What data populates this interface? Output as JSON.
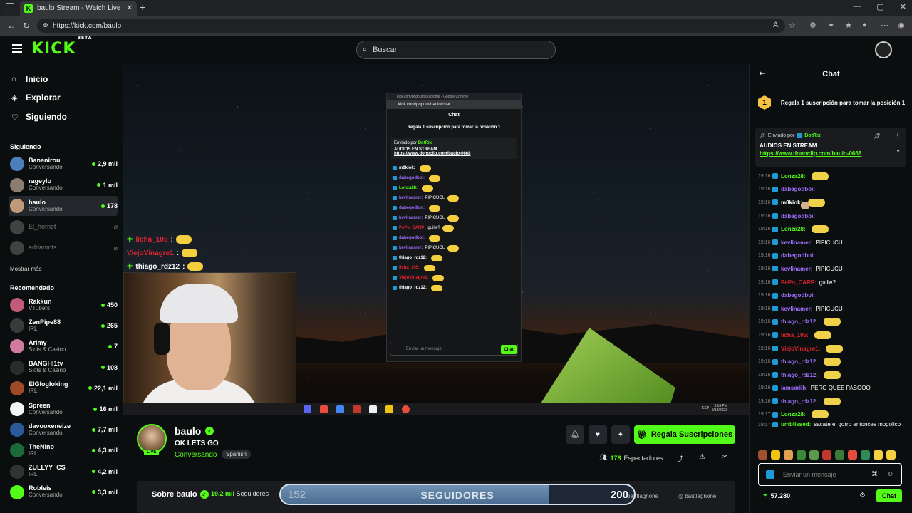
{
  "browser": {
    "tab_title": "baulo Stream - Watch Live o",
    "url": "https://kick.com/baulo",
    "new_tab": "+",
    "window_controls": [
      "—",
      "▢",
      "✕"
    ]
  },
  "header": {
    "logo": "KICK",
    "logo_tag": "BETA",
    "search_placeholder": "Buscar"
  },
  "sidebar": {
    "nav": [
      {
        "label": "Inicio",
        "icon": "home-icon"
      },
      {
        "label": "Explorar",
        "icon": "compass-icon"
      },
      {
        "label": "Siguiendo",
        "icon": "heart-icon"
      }
    ],
    "following_title": "Siguiendo",
    "following": [
      {
        "name": "Bananirou",
        "category": "Conversando",
        "viewers": "2,9 mil",
        "color": "#4c7fb8"
      },
      {
        "name": "rageylo",
        "category": "Conversando",
        "viewers": "1 mil",
        "color": "#8a7d70"
      },
      {
        "name": "baulo",
        "category": "Conversando",
        "viewers": "178",
        "color": "#c09a78"
      },
      {
        "name": "El_hornet",
        "category": "",
        "viewers": "",
        "color": "#777"
      },
      {
        "name": "adrianmts",
        "category": "",
        "viewers": "",
        "color": "#777"
      }
    ],
    "show_more": "Mostrar más",
    "recommended_title": "Recomendado",
    "recommended": [
      {
        "name": "Rakkun",
        "category": "VTubers",
        "viewers": "450",
        "color": "#c25a7a"
      },
      {
        "name": "ZenPipe88",
        "category": "IRL",
        "viewers": "265",
        "color": "#3a3a3a"
      },
      {
        "name": "Arimy",
        "category": "Slots & Casino",
        "viewers": "7",
        "color": "#d07aa0"
      },
      {
        "name": "BANGHI1tv",
        "category": "Slots & Casino",
        "viewers": "108",
        "color": "#2b2b2b"
      },
      {
        "name": "ElGlogloking",
        "category": "IRL",
        "viewers": "22,1 mil",
        "color": "#a04a2a"
      },
      {
        "name": "Spreen",
        "category": "Conversando",
        "viewers": "16 mil",
        "color": "#f5f5f5"
      },
      {
        "name": "davooxeneize",
        "category": "Conversando",
        "viewers": "7,7 mil",
        "color": "#2a5a9a"
      },
      {
        "name": "TheNino",
        "category": "IRL",
        "viewers": "4,3 mil",
        "color": "#1a6a3a"
      },
      {
        "name": "ZULLYY_CS",
        "category": "IRL",
        "viewers": "4,2 mil",
        "color": "#333"
      },
      {
        "name": "Robleis",
        "category": "Conversando",
        "viewers": "3,3 mil",
        "color": "#53fc18"
      }
    ]
  },
  "video": {
    "overlay_chat": [
      {
        "user": "licha_105",
        "sep": ":",
        "color": "#e0232f"
      },
      {
        "user": "ViejoVinagre1",
        "sep": ":",
        "color": "#e0232f"
      },
      {
        "user": "thiago_rdz12",
        "sep": ":",
        "color": "#ffffff"
      }
    ],
    "popout": {
      "window_title": "kick.com/popout/baulo/chat - Google Chrome",
      "url": "kick.com/popout/baulo/chat",
      "header": "Chat",
      "gift": "Regala 1 suscripción para tomar la posición 1",
      "pinned_by": "Enviado por",
      "pinned_user": "BotRix",
      "pinned_title": "AUDIOS EN STREAM",
      "pinned_link": "https://www.donoclip.com/baulo-0668",
      "input_placeholder": "Enviar un mensaje",
      "send": "Chat",
      "lines": [
        {
          "user": "m0kiok:",
          "text": "",
          "color": "#ffffff"
        },
        {
          "user": "dabegodboi:",
          "text": "",
          "color": "#a070ff"
        },
        {
          "user": "Lonza28:",
          "text": "",
          "color": "#53fc18"
        },
        {
          "user": "kevlinamer:",
          "text": "PIPICUCU",
          "color": "#a070ff"
        },
        {
          "user": "dabegodboi:",
          "text": "",
          "color": "#a070ff"
        },
        {
          "user": "kevlinamer:",
          "text": "PIPICUCU",
          "color": "#a070ff"
        },
        {
          "user": "PePo_CARP:",
          "text": "guille?",
          "color": "#e0232f"
        },
        {
          "user": "dabegodboi:",
          "text": "",
          "color": "#a070ff"
        },
        {
          "user": "kevlinamer:",
          "text": "PIPICUCU",
          "color": "#a070ff"
        },
        {
          "user": "thiago_rdz12:",
          "text": "",
          "color": "#ffffff"
        },
        {
          "user": "licha_105:",
          "text": "",
          "color": "#e0232f"
        },
        {
          "user": "ViejoVinagre1:",
          "text": "",
          "color": "#e0232f"
        },
        {
          "user": "thiago_rdz12:",
          "text": "",
          "color": "#ffffff"
        }
      ]
    },
    "taskbar": {
      "lang": "ESP",
      "time": "9:16 PM",
      "date": "9/13/2023"
    }
  },
  "stream": {
    "streamer": "baulo",
    "live": "LIVE",
    "title": "OK LETS GO",
    "category": "Conversando",
    "language": "Spanish",
    "subscribe": "Regala Suscripciones",
    "viewers_count": "178",
    "viewers_label": "Espectadores"
  },
  "about": {
    "title": "Sobre baulo",
    "followers_count": "19,2 mil",
    "followers_label": "Seguidores",
    "social_1": "bautlagnone",
    "social_2": "bautlagnone"
  },
  "goal": {
    "current": "152",
    "label": "SEGUIDORES",
    "target": "200",
    "progress": 0.76
  },
  "chat": {
    "header": "Chat",
    "gift": "Regala 1 suscripción para tomar la posición 1",
    "gift_rank": "1",
    "pinned_by": "Enviado por",
    "pinned_user": "BotRix",
    "pinned_title": "AUDIOS EN STREAM",
    "pinned_link": "https://www.donoclip.com/baulo-0668",
    "messages": [
      {
        "ts": "19:16",
        "user": "Lonza28:",
        "text": "",
        "color": "#53fc18",
        "emote": "yellow"
      },
      {
        "ts": "19:16",
        "user": "dabegodboi:",
        "text": "",
        "color": "#a070ff",
        "emote": "face"
      },
      {
        "ts": "19:16",
        "user": "m0kiok:",
        "text": "",
        "color": "#ffffff",
        "emote": "yellow"
      },
      {
        "ts": "19:16",
        "user": "dabegodboi:",
        "text": "",
        "color": "#a070ff",
        "emote": "face"
      },
      {
        "ts": "19:16",
        "user": "Lonza28:",
        "text": "",
        "color": "#53fc18",
        "emote": "yellow"
      },
      {
        "ts": "19:16",
        "user": "kevlinamer:",
        "text": "PIPICUCU",
        "color": "#a070ff",
        "emote": "face"
      },
      {
        "ts": "19:16",
        "user": "dabegodboi:",
        "text": "",
        "color": "#a070ff",
        "emote": "face"
      },
      {
        "ts": "19:16",
        "user": "kevlinamer:",
        "text": "PIPICUCU",
        "color": "#a070ff",
        "emote": "face"
      },
      {
        "ts": "19:16",
        "user": "PePo_CARP:",
        "text": "guille?",
        "color": "#e0232f",
        "emote": ""
      },
      {
        "ts": "19:16",
        "user": "dabegodboi:",
        "text": "",
        "color": "#a070ff",
        "emote": "face"
      },
      {
        "ts": "19:16",
        "user": "kevlinamer:",
        "text": "PIPICUCU",
        "color": "#a070ff",
        "emote": "face"
      },
      {
        "ts": "19:16",
        "user": "thiago_rdz12:",
        "text": "",
        "color": "#a070ff",
        "emote": "yellow"
      },
      {
        "ts": "19:16",
        "user": "licha_105:",
        "text": "",
        "color": "#e0232f",
        "emote": "yellow"
      },
      {
        "ts": "19:16",
        "user": "ViejoVinagre1:",
        "text": "",
        "color": "#e0232f",
        "emote": "yellow"
      },
      {
        "ts": "19:16",
        "user": "thiago_rdz12:",
        "text": "",
        "color": "#a070ff",
        "emote": "yellow"
      },
      {
        "ts": "19:16",
        "user": "thiago_rdz12:",
        "text": "",
        "color": "#a070ff",
        "emote": "yellow"
      },
      {
        "ts": "19:16",
        "user": "iamsariih:",
        "text": "PERO QUEE PASOOO",
        "color": "#a070ff",
        "emote": ""
      },
      {
        "ts": "19:16",
        "user": "thiago_rdz12:",
        "text": "",
        "color": "#a070ff",
        "emote": "yellow"
      },
      {
        "ts": "19:17",
        "user": "Lonza28:",
        "text": "",
        "color": "#53fc18",
        "emote": "yellow"
      },
      {
        "ts": "19:17",
        "user": "umblissed:",
        "text": "sacate el gorro entonces mogolico",
        "color": "#53fc18",
        "emote": ""
      }
    ],
    "input_placeholder": "Enviar un mensaje",
    "points": "57.280",
    "send": "Chat"
  }
}
